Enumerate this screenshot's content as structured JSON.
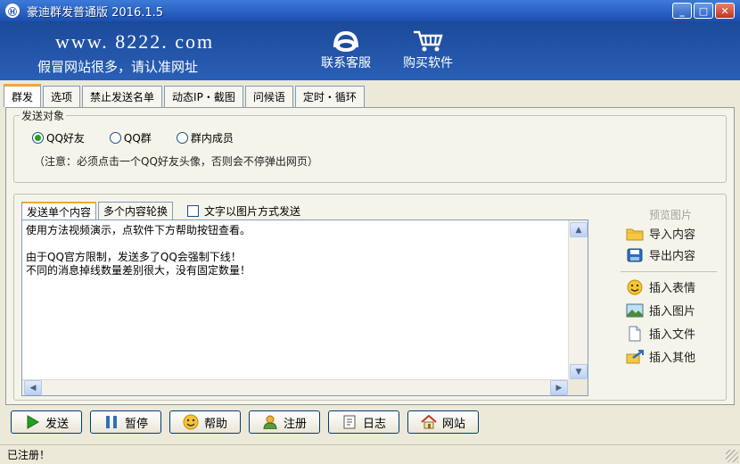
{
  "window": {
    "title": "豪迪群发普通版 2016.1.5",
    "app_icon_glyph": "Ⓗ",
    "minimize_glyph": "_",
    "maximize_glyph": "□",
    "close_glyph": "✕"
  },
  "banner": {
    "url": "www. 8222. com",
    "warning": "假冒网站很多，请认准网址",
    "customer_service": "联系客服",
    "buy": "购买软件"
  },
  "tabs": [
    {
      "label": "群发",
      "active": true
    },
    {
      "label": "选项"
    },
    {
      "label": "禁止发送名单"
    },
    {
      "label": "动态IP・截图"
    },
    {
      "label": "问候语"
    },
    {
      "label": "定时・循环"
    }
  ],
  "send_target": {
    "legend": "发送对象",
    "options": [
      {
        "label": "QQ好友",
        "selected": true
      },
      {
        "label": "QQ群",
        "selected": false
      },
      {
        "label": "群内成员",
        "selected": false
      }
    ],
    "note": "（注意：必须点击一个QQ好友头像，否则会不停弹出网页）"
  },
  "content": {
    "subtabs": [
      "发送单个内容",
      "多个内容轮换"
    ],
    "image_mode_label": "文字以图片方式发送",
    "lines": [
      "使用方法视频演示，点软件下方帮助按钮查看。",
      "",
      "由于QQ官方限制，发送多了QQ会强制下线！",
      "不同的消息掉线数量差别很大，没有固定数量！"
    ]
  },
  "side": {
    "preview": "预览图片",
    "import": "导入内容",
    "export": "导出内容",
    "insert_emoji": "插入表情",
    "insert_image": "插入图片",
    "insert_file": "插入文件",
    "insert_other": "插入其他"
  },
  "buttons": {
    "send": "发送",
    "pause": "暂停",
    "help": "帮助",
    "register": "注册",
    "log": "日志",
    "website": "网站"
  },
  "status": {
    "text": "已注册！"
  },
  "colors": {
    "titlebar": "#1c4fb0",
    "banner": "#1b4a99",
    "panel": "#ece9d8",
    "tab_highlight": "#f1a638",
    "send_green": "#21a121"
  },
  "icons": {
    "customer_service": "headset-icon",
    "buy": "shopping-cart-icon",
    "import": "folder-icon",
    "export": "save-icon",
    "insert_emoji": "smiley-icon",
    "insert_image": "picture-icon",
    "insert_file": "file-icon",
    "insert_other": "link-icon",
    "send": "play-icon",
    "pause": "pause-icon",
    "help": "smiley-icon",
    "register": "user-icon",
    "log": "document-icon",
    "website": "home-icon"
  }
}
